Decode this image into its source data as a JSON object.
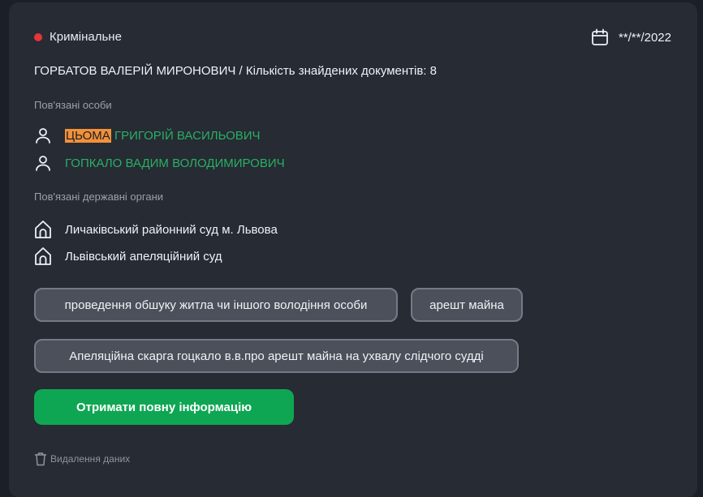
{
  "case": {
    "category": "Кримінальне",
    "date": "**/**/2022",
    "title": "ГОРБАТОВ ВАЛЕРІЙ МИРОНОВИЧ / Кількість знайдених документів: 8"
  },
  "related_persons": {
    "label": "Пов'язані особи",
    "items": [
      {
        "highlight": "ЦЬОМА",
        "rest": " ГРИГОРІЙ ВАСИЛЬОВИЧ",
        "icon": "person-icon"
      },
      {
        "highlight": "",
        "rest": "ГОПКАЛО ВАДИМ ВОЛОДИМИРОВИЧ",
        "icon": "person-icon"
      }
    ]
  },
  "related_orgs": {
    "label": "Пов'язані державні органи",
    "items": [
      {
        "name": "Личаківський районний суд м. Львова",
        "icon": "building-icon"
      },
      {
        "name": "Львівський апеляційний суд",
        "icon": "building-icon"
      }
    ]
  },
  "tags": [
    "проведення обшуку житла чи іншого володіння особи",
    "арешт майна",
    "Апеляційна скарга гоцкало в.в.про арешт майна на ухвалу слідчого судді"
  ],
  "actions": {
    "full_info": "Отримати повну інформацію",
    "delete_data": "Видалення даних"
  },
  "colors": {
    "status_dot": "#e5343a",
    "person_link": "#29b062",
    "highlight": "#f2913a",
    "cta": "#0fa653"
  }
}
